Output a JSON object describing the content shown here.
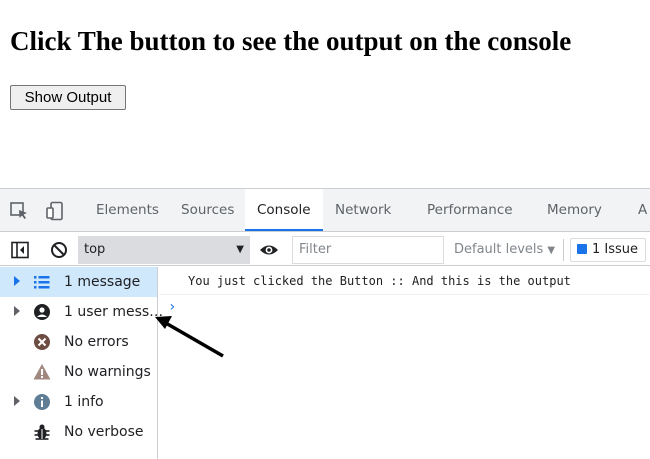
{
  "page": {
    "heading": "Click The button to see the output on the console",
    "button_label": "Show Output"
  },
  "devtools": {
    "tabs": [
      "Elements",
      "Sources",
      "Console",
      "Network",
      "Performance",
      "Memory",
      "A"
    ],
    "active_tab": "Console",
    "toolbar": {
      "context": "top",
      "filter_placeholder": "Filter",
      "levels_label": "Default levels",
      "issues_label": "1 Issue"
    },
    "sidebar": [
      {
        "label": "1 message",
        "icon": "list-icon",
        "selected": true
      },
      {
        "label": "1 user mess…",
        "icon": "user-icon",
        "selected": false
      },
      {
        "label": "No errors",
        "icon": "error-icon",
        "selected": false
      },
      {
        "label": "No warnings",
        "icon": "warning-icon",
        "selected": false
      },
      {
        "label": "1 info",
        "icon": "info-icon",
        "selected": false
      },
      {
        "label": "No verbose",
        "icon": "bug-icon",
        "selected": false
      }
    ],
    "console_output": "You just clicked the Button  :: And this is the output",
    "prompt_symbol": "›"
  },
  "colors": {
    "accent": "#1a73e8",
    "selected_bg": "#cfe8fc",
    "tabbar_bg": "#f1f3f4"
  }
}
